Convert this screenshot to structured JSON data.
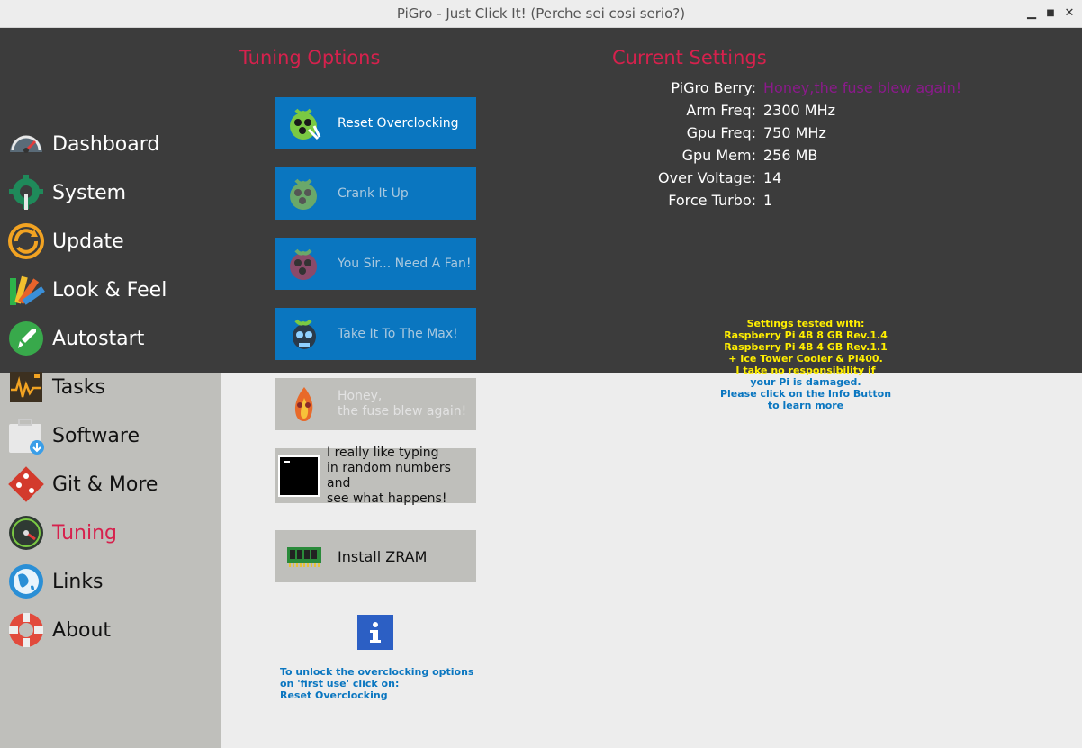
{
  "window": {
    "title": "PiGro - Just Click It! (Perche sei cosi serio?)",
    "minimize": "▁",
    "maximize": "■",
    "close": "✕"
  },
  "sidebar": {
    "items": [
      {
        "label": "Dashboard",
        "icon": "gauge-icon"
      },
      {
        "label": "System",
        "icon": "gear-wrench-icon"
      },
      {
        "label": "Update",
        "icon": "update-icon"
      },
      {
        "label": "Look & Feel",
        "icon": "palette-icon"
      },
      {
        "label": "Autostart",
        "icon": "rocket-icon"
      },
      {
        "label": "Tasks",
        "icon": "tasks-monitor-icon"
      },
      {
        "label": "Software",
        "icon": "software-bag-icon"
      },
      {
        "label": "Git & More",
        "icon": "git-icon"
      },
      {
        "label": "Tuning",
        "icon": "speedometer-icon"
      },
      {
        "label": "Links",
        "icon": "globe-icon"
      },
      {
        "label": "About",
        "icon": "lifebuoy-icon"
      }
    ],
    "active": "Tuning"
  },
  "tuning": {
    "title": "Tuning Options",
    "buttons": {
      "reset": "Reset Overclocking",
      "crank": "Crank It Up",
      "fan": "You Sir... Need A Fan!",
      "max": "Take It To The Max!",
      "fuse_line1": "Honey,",
      "fuse_line2": "the fuse blew again!",
      "random_line1": "I really like typing",
      "random_line2": "in random numbers and",
      "random_line3": "see what happens!",
      "zram": "Install ZRAM"
    },
    "unlock_line1": "To unlock the overclocking options",
    "unlock_line2": "on 'first use' click on:",
    "unlock_line3": "Reset Overclocking"
  },
  "current": {
    "title": "Current Settings",
    "rows": [
      {
        "key": "PiGro Berry:",
        "value": "Honey,the fuse blew again!"
      },
      {
        "key": "Arm Freq:",
        "value": "2300 MHz"
      },
      {
        "key": "Gpu Freq:",
        "value": "750 MHz"
      },
      {
        "key": "Gpu Mem:",
        "value": "256 MB"
      },
      {
        "key": "Over Voltage:",
        "value": "14"
      },
      {
        "key": "Force Turbo:",
        "value": "1"
      }
    ]
  },
  "notice": {
    "l1": "Settings tested with:",
    "l2": "Raspberry Pi 4B 8 GB Rev.1.4",
    "l3": "Raspberry Pi 4B 4 GB Rev.1.1",
    "l4": "+ Ice Tower Cooler & Pi400.",
    "l5": "I take no responsibility if",
    "l6": "your Pi is damaged.",
    "l7": "Please click on the Info Button",
    "l8": "to learn more"
  },
  "colors": {
    "accent": "#d6214d",
    "blue": "#0a76c0",
    "dark": "#3c3c3c",
    "berry_value": "#8b1a8b"
  }
}
